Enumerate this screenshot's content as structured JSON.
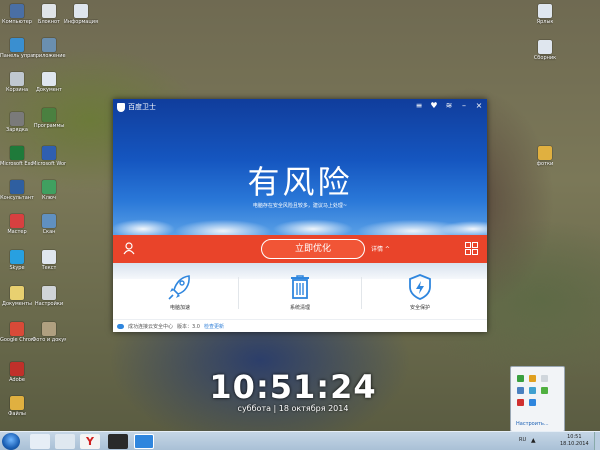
{
  "desktop": {
    "icons_left": [
      {
        "label": "Компьютер",
        "color": "#4a6fa5"
      },
      {
        "label": "Панель управления",
        "color": "#3a8fd0"
      },
      {
        "label": "Корзина",
        "color": "#c0c8d0"
      },
      {
        "label": "Зарядка",
        "color": "#7a7a7a"
      },
      {
        "label": "Microsoft Excel",
        "color": "#1f7a3a"
      },
      {
        "label": "Консультант",
        "color": "#2f5fa0"
      },
      {
        "label": "Мастер",
        "color": "#d84040"
      },
      {
        "label": "Skype",
        "color": "#28a0e0"
      },
      {
        "label": "Документы",
        "color": "#e8d070"
      },
      {
        "label": "Google Chrome",
        "color": "#d84a38"
      },
      {
        "label": "Adobe",
        "color": "#c0302a"
      },
      {
        "label": "Файлы",
        "color": "#e0b040"
      }
    ],
    "icons_col2": [
      {
        "label": "Блокнот",
        "color": "#e0e4e8"
      },
      {
        "label": "приложение",
        "color": "#6a8fb0"
      },
      {
        "label": "Документ",
        "color": "#dfe6ee"
      },
      {
        "label": "Программы",
        "color": "#4a8040"
      },
      {
        "label": "Microsoft Word",
        "color": "#2f5fb0"
      },
      {
        "label": "Ключ",
        "color": "#40a060"
      },
      {
        "label": "Скан",
        "color": "#6090c0"
      },
      {
        "label": "Текст",
        "color": "#dfe6ee"
      },
      {
        "label": "Настройки",
        "color": "#d0d4d8"
      },
      {
        "label": "Фото и документы",
        "color": "#b0a080"
      }
    ],
    "icons_col3": [
      {
        "label": "Информация",
        "color": "#dfe6ee"
      }
    ],
    "icons_right": [
      {
        "label": "Ярлык",
        "color": "#dfe6ee"
      },
      {
        "label": "Сборник",
        "color": "#dfe6ee"
      },
      {
        "label": "фотки",
        "color": "#e0b040"
      },
      {
        "label": "Корзина",
        "color": "#c0c8d0"
      }
    ]
  },
  "window": {
    "title": "百度卫士",
    "buttons": [
      "menu",
      "skin",
      "wifi",
      "minimize",
      "close"
    ],
    "risk_text": "有风险",
    "subtitle": "电脑存在安全风险且较多，建议马上处理~",
    "optimize_label": "立即优化",
    "detail_label": "详情 ^",
    "tools": [
      {
        "label": "电脑加速",
        "icon": "rocket-icon"
      },
      {
        "label": "系统清理",
        "icon": "trash-icon"
      },
      {
        "label": "安全保护",
        "icon": "shield-icon"
      }
    ],
    "status": {
      "connected": "成功连接云安全中心",
      "version": "版本：3.0",
      "check_update": "检查更新"
    },
    "colors": {
      "hero_top": "#103d9c",
      "hero_bottom": "#5aa0e6",
      "bar": "#e9442a",
      "accent_blue": "#2f86de"
    }
  },
  "clock": {
    "time": "10:51:24",
    "date": "суббота | 18 октября 2014"
  },
  "tray_popup": {
    "customize": "Настроить..."
  },
  "taskbar": {
    "lang": "RU",
    "time": "10:51",
    "date": "18.10.2014"
  }
}
